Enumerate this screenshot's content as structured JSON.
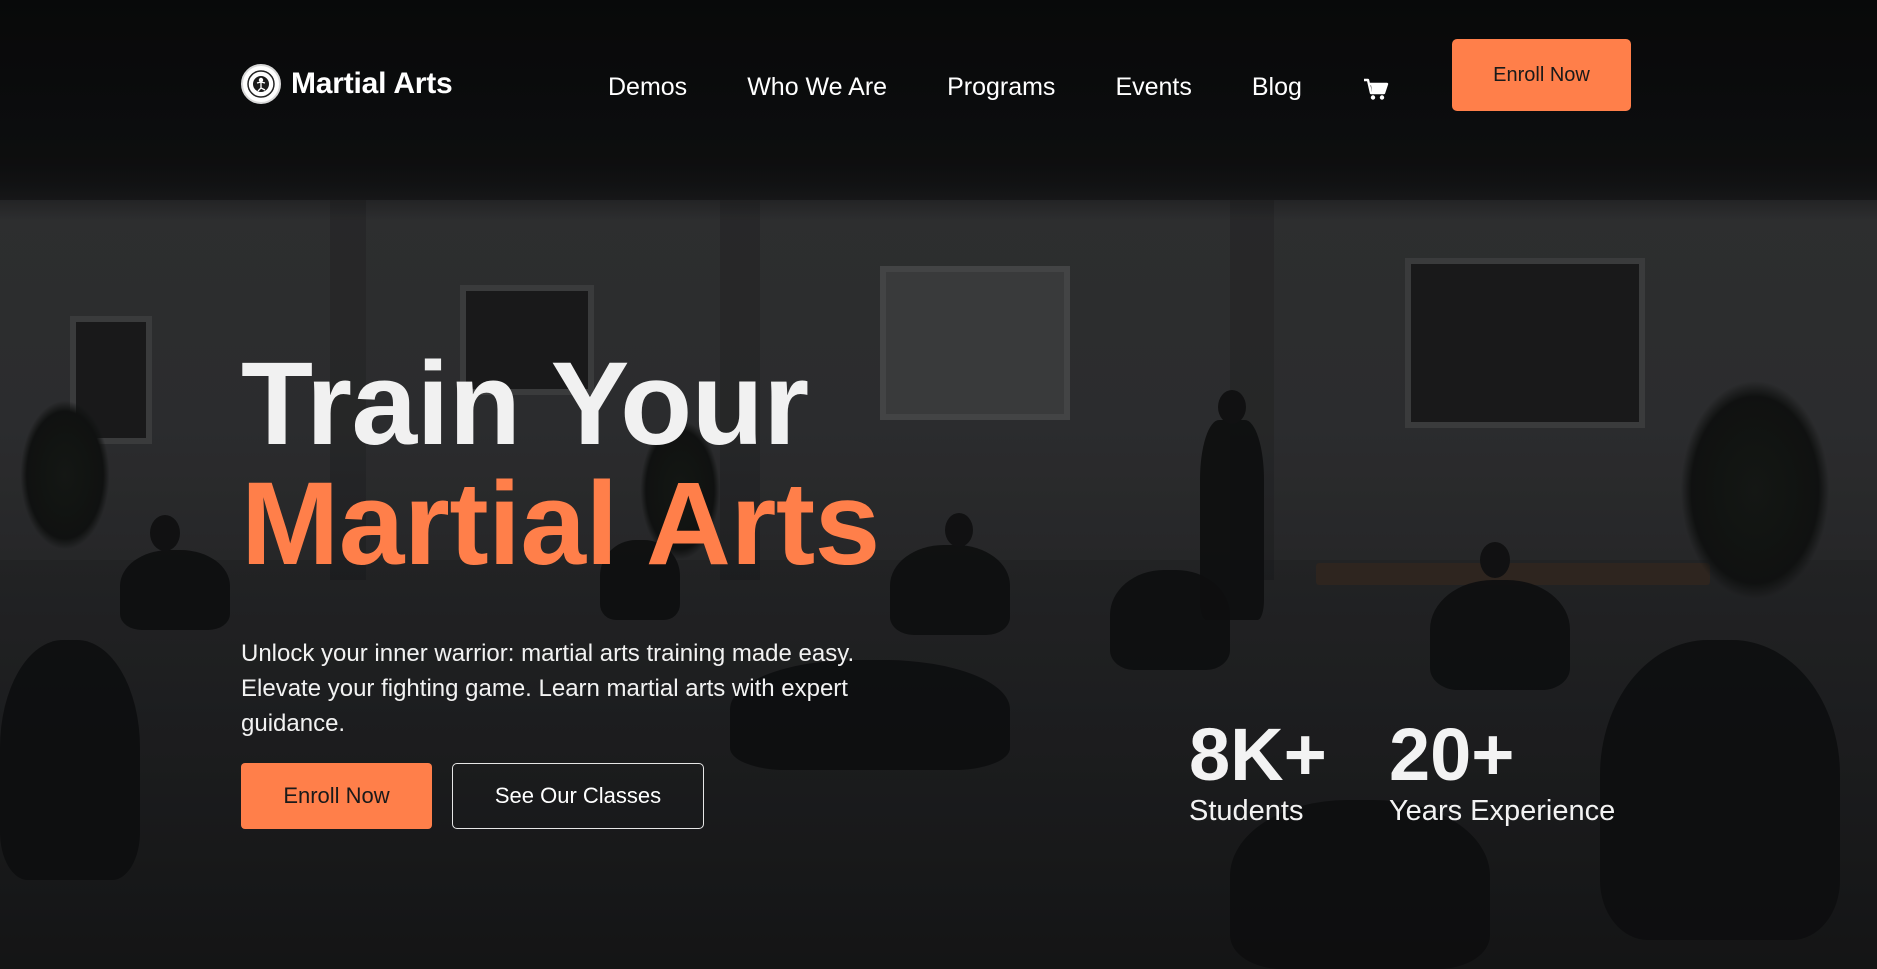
{
  "brand": {
    "name": "Martial Arts",
    "logo_icon": "martial-arts-emblem-icon"
  },
  "nav": {
    "items": [
      {
        "label": "Demos"
      },
      {
        "label": "Who We Are"
      },
      {
        "label": "Programs"
      },
      {
        "label": "Events"
      },
      {
        "label": "Blog"
      }
    ],
    "cart_icon": "shopping-cart-icon",
    "enroll_label": "Enroll Now"
  },
  "hero": {
    "title_line1": "Train Your",
    "title_line2": "Martial Arts",
    "subtitle": "Unlock your inner warrior: martial arts training made easy. Elevate your fighting game. Learn martial arts with expert guidance.",
    "primary_button": "Enroll Now",
    "secondary_button": "See Our Classes"
  },
  "stats": [
    {
      "value": "8K+",
      "label": "Students"
    },
    {
      "value": "20+",
      "label": "Years Experience"
    }
  ],
  "colors": {
    "accent": "#ff7f4a",
    "text": "#ffffff",
    "background": "#1b1c1e"
  }
}
